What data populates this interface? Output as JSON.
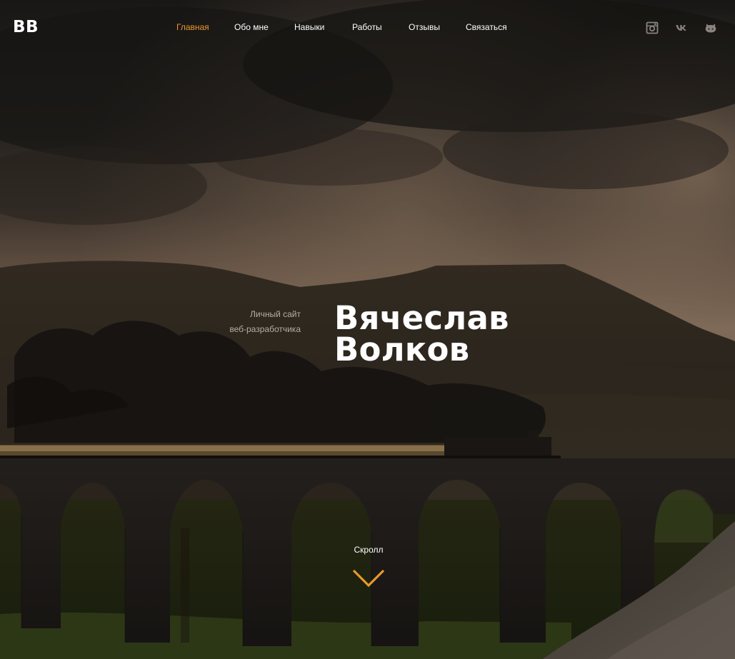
{
  "logo": {
    "text": "BB"
  },
  "nav": {
    "items": [
      {
        "label": "Главная",
        "active": true
      },
      {
        "label": "Обо мне",
        "active": false
      },
      {
        "label": "Навыки",
        "active": false
      },
      {
        "label": "Работы",
        "active": false
      },
      {
        "label": "Отзывы",
        "active": false
      },
      {
        "label": "Связаться",
        "active": false
      }
    ]
  },
  "social": {
    "icons": [
      "instagram-icon",
      "vk-icon",
      "github-icon"
    ]
  },
  "hero": {
    "subtitle_line1": "Личный сайт",
    "subtitle_line2": "веб-разработчика",
    "name_line1": "Вячеслав",
    "name_line2": "Волков",
    "background": "storm clouds, hills, steam train on stone viaduct"
  },
  "scroll": {
    "label": "Скролл",
    "icon": "chevron-down-icon"
  },
  "colors": {
    "accent": "#e8972e",
    "text": "#ffffff",
    "muted": "#b8ada2",
    "icon": "#8a847e"
  }
}
